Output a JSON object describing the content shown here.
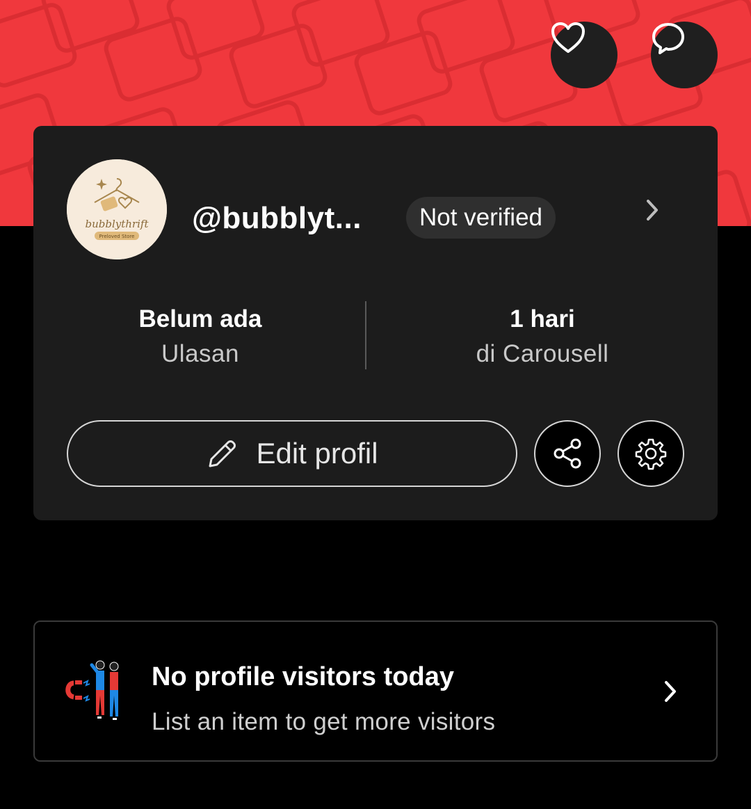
{
  "header": {
    "favorites_icon": "heart-icon",
    "chat_icon": "chat-bubble-icon"
  },
  "profile": {
    "avatar_text": "bubblythrift",
    "avatar_subtext": "Preloved Store",
    "username": "@bubblyt...",
    "verification_badge": "Not verified",
    "stats": [
      {
        "value": "Belum ada",
        "label": "Ulasan"
      },
      {
        "value": "1 hari",
        "label": "di Carousell"
      }
    ],
    "edit_button_label": "Edit profil",
    "share_icon": "share-icon",
    "settings_icon": "gear-icon"
  },
  "visitors": {
    "title": "No profile visitors today",
    "subtitle": "List an item to get more visitors"
  },
  "colors": {
    "banner": "#f0383d",
    "background": "#000000",
    "card": "#1c1c1c",
    "badge": "#2f2f2f"
  }
}
